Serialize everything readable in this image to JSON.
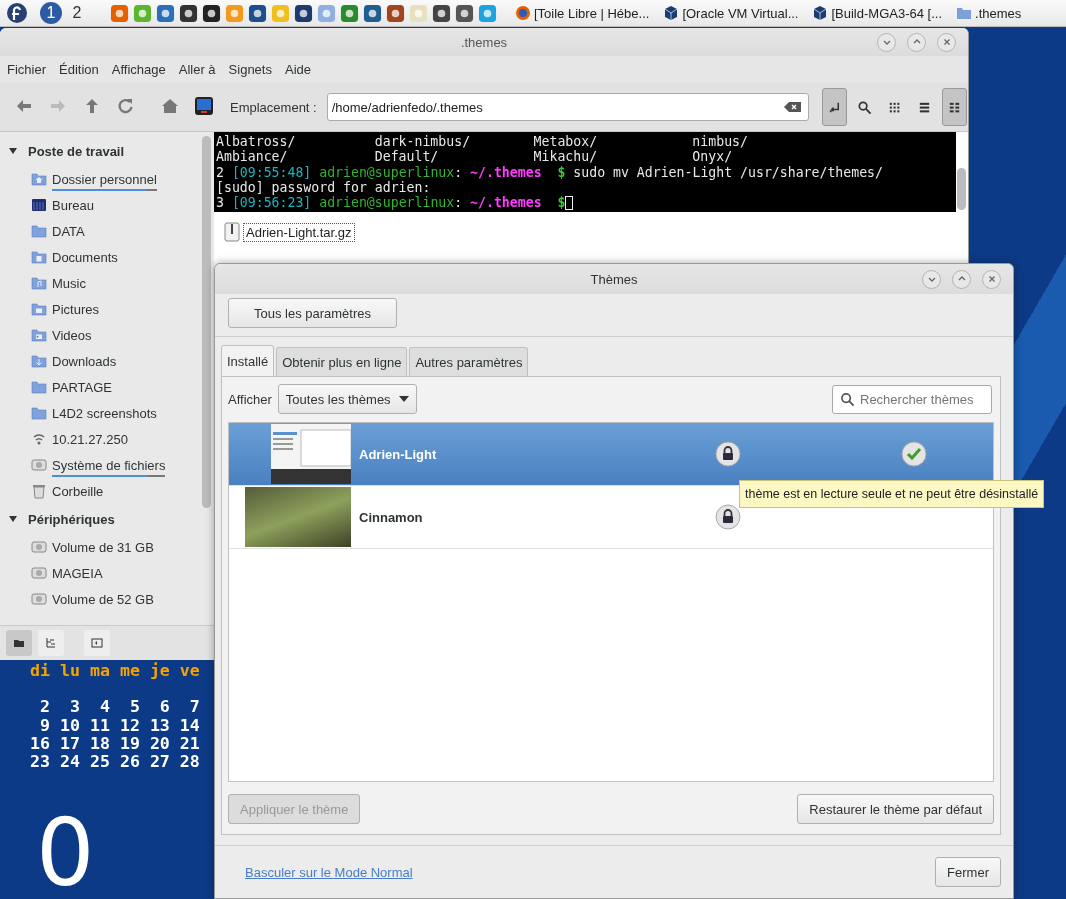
{
  "panel": {
    "workspaces": [
      {
        "label": "1",
        "selected": true
      },
      {
        "label": "2",
        "selected": false
      }
    ],
    "tasks": [
      {
        "label": "[Toile Libre | Hébe...",
        "kind": "browser"
      },
      {
        "label": "[Oracle VM Virtual...",
        "kind": "vm"
      },
      {
        "label": "[Build-MGA3-64 [...",
        "kind": "vm"
      },
      {
        "label": ".themes",
        "kind": "folder"
      }
    ]
  },
  "file_manager": {
    "title": ".themes",
    "menu": [
      "Fichier",
      "Édition",
      "Affichage",
      "Aller à",
      "Signets",
      "Aide"
    ],
    "nav": [
      {
        "kind": "back",
        "disabled": false
      },
      {
        "kind": "forward",
        "disabled": true
      },
      {
        "kind": "up",
        "disabled": false
      },
      {
        "kind": "reload",
        "disabled": false
      }
    ],
    "location_label": "Emplacement :",
    "location": "/home/adrienfedo/.themes",
    "views": [
      {
        "kind": "location-toggle",
        "selected": true
      },
      {
        "kind": "search",
        "selected": false
      },
      {
        "kind": "grid",
        "selected": false
      },
      {
        "kind": "list",
        "selected": false
      },
      {
        "kind": "compact",
        "selected": true
      }
    ],
    "sidebar": [
      {
        "heading": "Poste de travail",
        "expanded": true,
        "items": [
          {
            "label": "Dossier personnel",
            "kind": "home",
            "level": 0.9
          },
          {
            "label": "Bureau",
            "kind": "desktop"
          },
          {
            "label": "DATA",
            "kind": "folder"
          },
          {
            "label": "Documents",
            "kind": "documents"
          },
          {
            "label": "Music",
            "kind": "music"
          },
          {
            "label": "Pictures",
            "kind": "pictures"
          },
          {
            "label": "Videos",
            "kind": "videos"
          },
          {
            "label": "Downloads",
            "kind": "downloads"
          },
          {
            "label": "PARTAGE",
            "kind": "folder"
          },
          {
            "label": "L4D2 screenshots",
            "kind": "folder"
          },
          {
            "label": "10.21.27.250",
            "kind": "network"
          },
          {
            "label": "Système de fichiers",
            "kind": "drive",
            "level": 0.85
          },
          {
            "label": "Corbeille",
            "kind": "trash"
          }
        ]
      },
      {
        "heading": "Périphériques",
        "expanded": true,
        "items": [
          {
            "label": "Volume de 31 GB",
            "kind": "drive"
          },
          {
            "label": "MAGEIA",
            "kind": "drive"
          },
          {
            "label": "Volume de 52 GB",
            "kind": "drive"
          }
        ]
      }
    ],
    "terminal": [
      [
        {
          "kind": "plain",
          "text": "Albatross/          dark-nimbus/        Metabox/            nimbus/"
        }
      ],
      [
        {
          "kind": "plain",
          "text": "Ambiance/           Default/            Mikachu/            Onyx/"
        }
      ],
      [
        {
          "kind": "plain",
          "text": "2 "
        },
        {
          "kind": "time",
          "text": "[09:55:48]"
        },
        {
          "kind": "user",
          "text": " adrien@superlinux"
        },
        {
          "kind": "plain",
          "text": ": "
        },
        {
          "kind": "path",
          "text": "~/.themes"
        },
        {
          "kind": "prompt",
          "text": "  $"
        },
        {
          "kind": "plain",
          "text": " sudo mv Adrien-Light /usr/share/themes/"
        }
      ],
      [
        {
          "kind": "plain",
          "text": "[sudo] password for adrien:"
        }
      ],
      [
        {
          "kind": "plain",
          "text": "3 "
        },
        {
          "kind": "time",
          "text": "[09:56:23]"
        },
        {
          "kind": "user",
          "text": " adrien@superlinux"
        },
        {
          "kind": "plain",
          "text": ": "
        },
        {
          "kind": "path",
          "text": "~/.themes"
        },
        {
          "kind": "prompt",
          "text": "  $"
        },
        {
          "kind": "cursor"
        }
      ]
    ],
    "files": [
      {
        "name": "Adrien-Light.tar.gz",
        "kind": "archive"
      }
    ],
    "bottom_tools": [
      {
        "kind": "places",
        "selected": true
      },
      {
        "kind": "tree",
        "selected": false
      },
      {
        "kind": "hide",
        "selected": false
      }
    ]
  },
  "calendar": {
    "weekdays": "di lu ma me je ve",
    "weeks": [
      " 2  3  4  5  6  7",
      " 9 10 11 12 13 14",
      "16 17 18 19 20 21",
      "23 24 25 26 27 28"
    ]
  },
  "clock": "0",
  "themes_dialog": {
    "title": "Thèmes",
    "all_settings": "Tous les paramètres",
    "tabs": [
      {
        "label": "Installé",
        "selected": true
      },
      {
        "label": "Obtenir plus en ligne",
        "selected": false
      },
      {
        "label": "Autres paramètres",
        "selected": false
      }
    ],
    "filter_label": "Afficher",
    "filter_value": "Toutes les thèmes",
    "search": {
      "placeholder": "Rechercher thèmes"
    },
    "themes": [
      {
        "name": "Adrien-Light",
        "selected": true,
        "read_only": true,
        "active": true,
        "kind": "screenshot"
      },
      {
        "name": "Cinnamon",
        "selected": false,
        "read_only": true,
        "active": false,
        "kind": "photo"
      }
    ],
    "tooltip": "thème est en lecture seule et ne peut être désinstallé",
    "apply": {
      "label": "Appliquer le thème",
      "disabled": true
    },
    "restore": "Restaurer le thème par défaut",
    "mode_link": "Basculer sur le Mode Normal",
    "close": "Fermer"
  }
}
